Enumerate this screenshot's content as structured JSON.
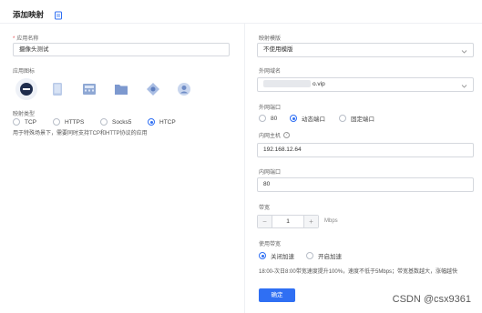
{
  "header": {
    "title": "添加映射"
  },
  "left": {
    "app_name": {
      "label": "应用名称",
      "required_mark": "*",
      "value": "摄像头测试"
    },
    "app_icon_label": "应用图标",
    "icons": [
      "minus-circle-icon",
      "tablet-icon",
      "calculator-icon",
      "folder-icon",
      "network-icon",
      "user-icon"
    ],
    "mapping_type": {
      "label": "映射类型",
      "options": [
        "TCP",
        "HTTPS",
        "Socks5",
        "HTCP"
      ],
      "selected": "HTCP",
      "hint": "用于特殊场景下，需要同时支持TCP和HTTP协议的应用"
    }
  },
  "right": {
    "template": {
      "label": "映射模版",
      "value": "不使用模版"
    },
    "domain": {
      "label": "外网域名",
      "value": "o.vip"
    },
    "port": {
      "label": "外网端口",
      "options": [
        "80",
        "动态端口",
        "固定端口"
      ],
      "selected": "动态端口"
    },
    "host": {
      "label": "内网主机",
      "help_icon": "?",
      "value": "192.168.12.64"
    },
    "inner_port": {
      "label": "内网端口",
      "value": "80"
    },
    "bandwidth": {
      "label": "带宽",
      "minus": "−",
      "value": "1",
      "plus": "+",
      "unit": "Mbps"
    },
    "speedup": {
      "label": "使用带宽",
      "options": [
        "关闭加速",
        "开启加速"
      ],
      "selected": "关闭加速",
      "hint": "18:00-次日8:00带宽速度提升100%，速度不低于5Mbps；带宽基数越大，涨幅越快"
    },
    "confirm_label": "确定"
  },
  "watermark": "CSDN @csx9361",
  "colors": {
    "accent": "#2f6ff3",
    "required": "#e5484d"
  }
}
